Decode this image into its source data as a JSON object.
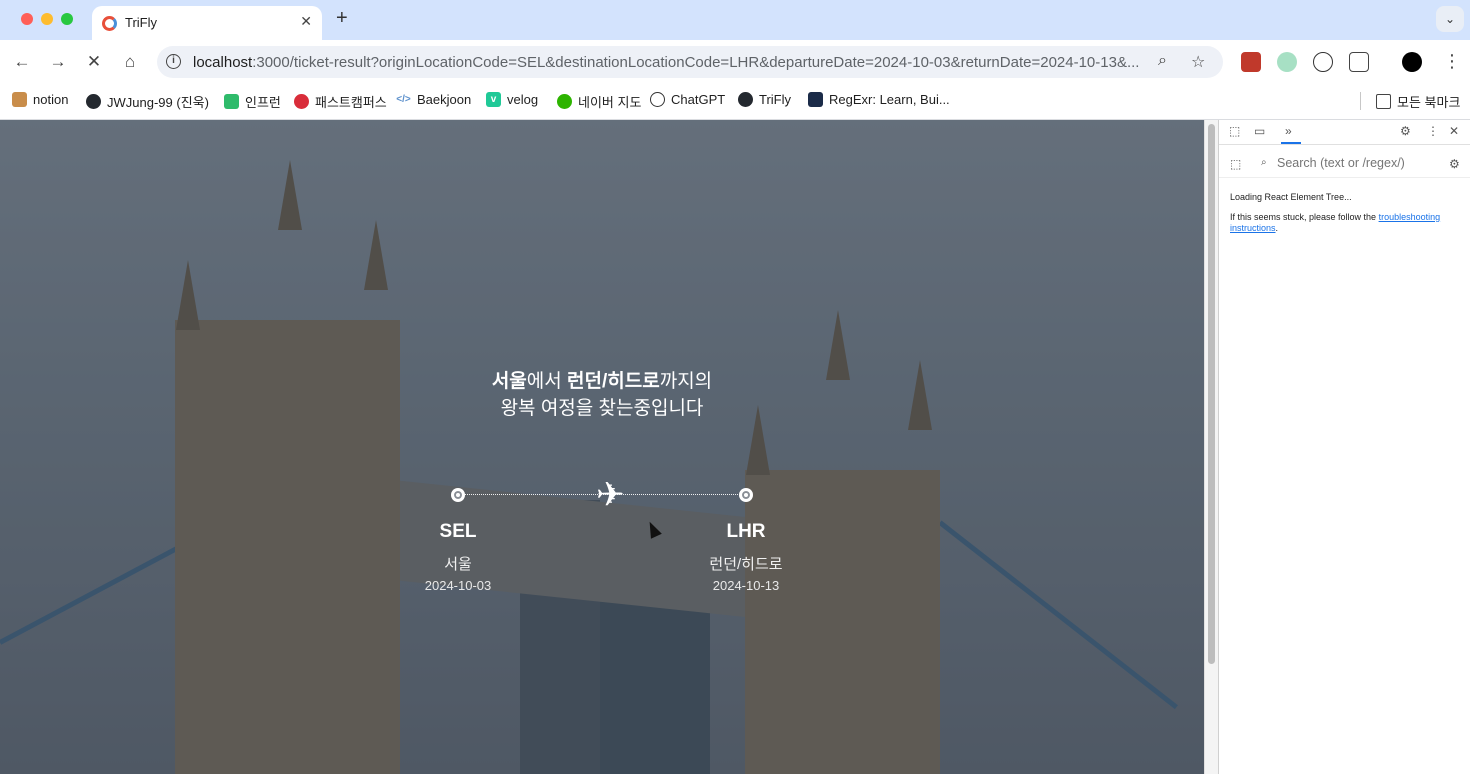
{
  "browser": {
    "tab": {
      "title": "TriFly",
      "close": "✕"
    },
    "new_tab": "+",
    "tab_menu": "⌄",
    "nav": {
      "back": "←",
      "forward": "→",
      "stop": "✕",
      "home": "⌂"
    },
    "url": {
      "host": "localhost",
      "rest": ":3000/ticket-result?originLocationCode=SEL&destinationLocationCode=LHR&departureDate=2024-10-03&returnDate=2024-10-13&..."
    },
    "omnibox_icons": {
      "zoom": "⌕",
      "bookmark": "☆"
    },
    "bookmarks": [
      {
        "label": "notion",
        "color": "#c98d4a"
      },
      {
        "label": "JWJung-99 (진욱)",
        "color": "#24292f"
      },
      {
        "label": "인프런",
        "color": "#2fbb6b"
      },
      {
        "label": "패스트캠퍼스",
        "color": "#d92d3a"
      },
      {
        "label": "Baekjoon",
        "color": "#5a8fcb"
      },
      {
        "label": "velog",
        "color": "#20c997"
      },
      {
        "label": "네이버 지도",
        "color": "#2db400"
      },
      {
        "label": "ChatGPT",
        "color": "#333333"
      },
      {
        "label": "TriFly",
        "color": "#24292f"
      },
      {
        "label": "RegExr: Learn, Bui...",
        "color": "#1b2b48"
      }
    ],
    "all_bookmarks": "모든 북마크"
  },
  "page": {
    "headline": {
      "origin": "서울",
      "part1": "에서 ",
      "destination": "런던/히드로",
      "part2": "까지의",
      "line2": "왕복 여정을 찾는중입니다"
    },
    "origin": {
      "code": "SEL",
      "city": "서울",
      "date": "2024-10-03"
    },
    "destination": {
      "code": "LHR",
      "city": "런던/히드로",
      "date": "2024-10-13"
    },
    "plane_icon": "✈"
  },
  "devtools": {
    "search_placeholder": "Search (text or /regex/)",
    "loading": "Loading React Element Tree...",
    "stuck_prefix": "If this seems stuck, please follow the ",
    "link_text_1": "troubleshooting",
    "link_text_2": "instructions",
    "period": "."
  }
}
